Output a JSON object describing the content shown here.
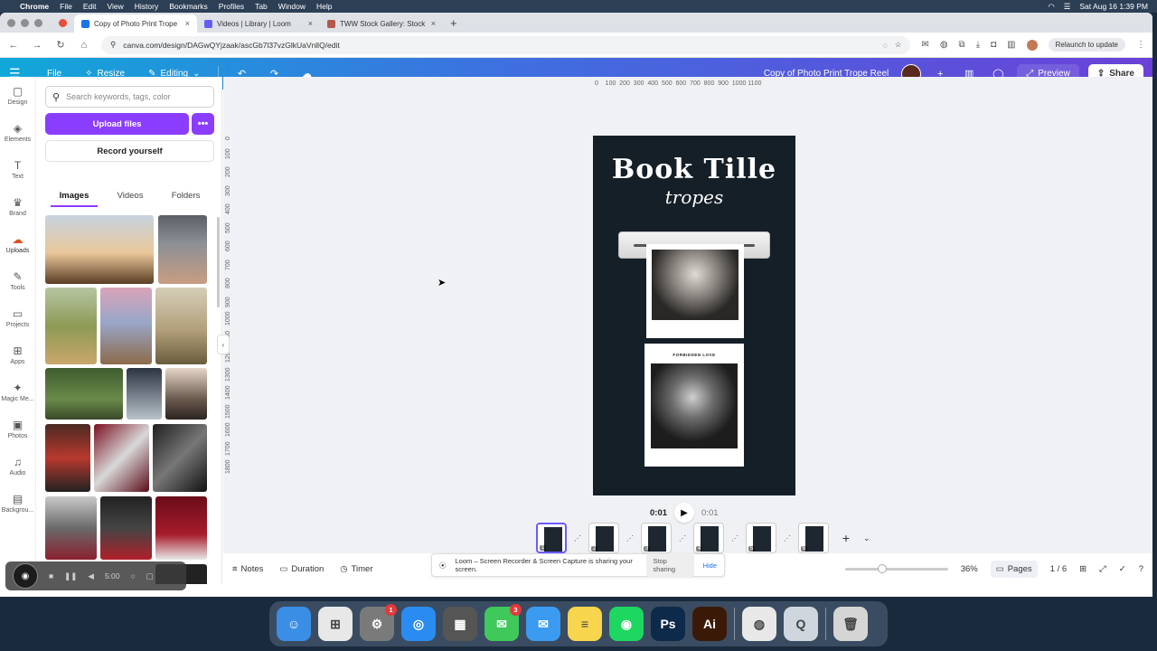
{
  "menubar": {
    "app": "Chrome",
    "items": [
      "File",
      "Edit",
      "View",
      "History",
      "Bookmarks",
      "Profiles",
      "Tab",
      "Window",
      "Help"
    ],
    "datetime": "Sat Aug 16  1:39 PM"
  },
  "browser": {
    "tabs": [
      {
        "label": "Copy of Photo Print Trope",
        "active": true,
        "color": "#1a73e8"
      },
      {
        "label": "Videos | Library | Loom",
        "active": false,
        "color": "#625df5"
      },
      {
        "label": "TWW Stock Gallery: Stock Im",
        "active": false,
        "color": "#b5574b"
      }
    ],
    "url": "canva.com/design/DAGwQYjzaak/ascGb7l37vzGlkUaVnllQ/edit",
    "relaunch": "Relaunch to update"
  },
  "canva_header": {
    "file": "File",
    "resize": "Resize",
    "editing": "Editing",
    "doc_title": "Copy of Photo Print Trope Reel",
    "preview": "Preview",
    "share": "Share"
  },
  "rail": [
    {
      "label": "Design",
      "icon": "design-icon",
      "glyph": "▢"
    },
    {
      "label": "Elements",
      "icon": "elements-icon",
      "glyph": "◈"
    },
    {
      "label": "Text",
      "icon": "text-icon",
      "glyph": "T"
    },
    {
      "label": "Brand",
      "icon": "brand-icon",
      "glyph": "♛"
    },
    {
      "label": "Uploads",
      "icon": "uploads-icon",
      "glyph": "☁"
    },
    {
      "label": "Tools",
      "icon": "tools-icon",
      "glyph": "✎"
    },
    {
      "label": "Projects",
      "icon": "projects-icon",
      "glyph": "▭"
    },
    {
      "label": "Apps",
      "icon": "apps-icon",
      "glyph": "⊞"
    },
    {
      "label": "Magic Me...",
      "icon": "magic-media-icon",
      "glyph": "✦"
    },
    {
      "label": "Photos",
      "icon": "photos-icon",
      "glyph": "▣"
    },
    {
      "label": "Audio",
      "icon": "audio-icon",
      "glyph": "♫"
    },
    {
      "label": "Backgrou...",
      "icon": "background-icon",
      "glyph": "▤"
    }
  ],
  "panel": {
    "search_placeholder": "Search keywords, tags, color",
    "upload": "Upload files",
    "more": "•••",
    "record": "Record yourself",
    "tabs": [
      "Images",
      "Videos",
      "Folders"
    ]
  },
  "loom_widget": {
    "time": "5:00"
  },
  "ruler_top": "0    100  200  300  400  500  600  700  800  900  1000 1100",
  "ruler_left": [
    "0",
    "100",
    "200",
    "300",
    "400",
    "500",
    "600",
    "700",
    "800",
    "900",
    "1000",
    "1100",
    "1200",
    "1300",
    "1400",
    "1500",
    "1600",
    "1700",
    "1800"
  ],
  "design": {
    "title": "Book Tille",
    "subtitle": "tropes",
    "caption": "FORBIDDEN LOVE"
  },
  "playback": {
    "current": "0:01",
    "total": "0:01"
  },
  "pages": [
    "1",
    "2",
    "3",
    "4",
    "5",
    "6"
  ],
  "bottombar": {
    "notes": "Notes",
    "duration": "Duration",
    "timer": "Timer",
    "zoom": "36%",
    "pages": "Pages",
    "page_count": "1 / 6",
    "zoom_level": 0.36
  },
  "loom_bar": {
    "message": "Loom – Screen Recorder & Screen Capture is sharing your screen.",
    "stop": "Stop sharing",
    "hide": "Hide"
  },
  "dock": [
    {
      "name": "finder-icon",
      "color": "#3a8ee6",
      "glyph": "☺"
    },
    {
      "name": "launchpad-icon",
      "color": "#e8e8e8",
      "glyph": "⊞"
    },
    {
      "name": "system-settings-icon",
      "color": "#7a7a7a",
      "glyph": "⚙",
      "badge": "1"
    },
    {
      "name": "safari-icon",
      "color": "#2a8cf0",
      "glyph": "◎"
    },
    {
      "name": "calculator-icon",
      "color": "#555",
      "glyph": "▦"
    },
    {
      "name": "messages-icon",
      "color": "#3ec95a",
      "glyph": "✉",
      "badge": "3"
    },
    {
      "name": "mail-icon",
      "color": "#3a9bf0",
      "glyph": "✉"
    },
    {
      "name": "notes-icon",
      "color": "#f7d54c",
      "glyph": "≡"
    },
    {
      "name": "spotify-icon",
      "color": "#1ed760",
      "glyph": "◉"
    },
    {
      "name": "photoshop-icon",
      "color": "#0e2a4a",
      "glyph": "Ps"
    },
    {
      "name": "illustrator-icon",
      "color": "#3a1a06",
      "glyph": "Ai"
    },
    {
      "name": "chrome-icon",
      "color": "#e8e8e8",
      "glyph": "◍"
    },
    {
      "name": "quicktime-icon",
      "color": "#cfd6de",
      "glyph": "Q"
    },
    {
      "name": "trash-icon",
      "color": "#d5d5d5",
      "glyph": "🗑"
    }
  ]
}
